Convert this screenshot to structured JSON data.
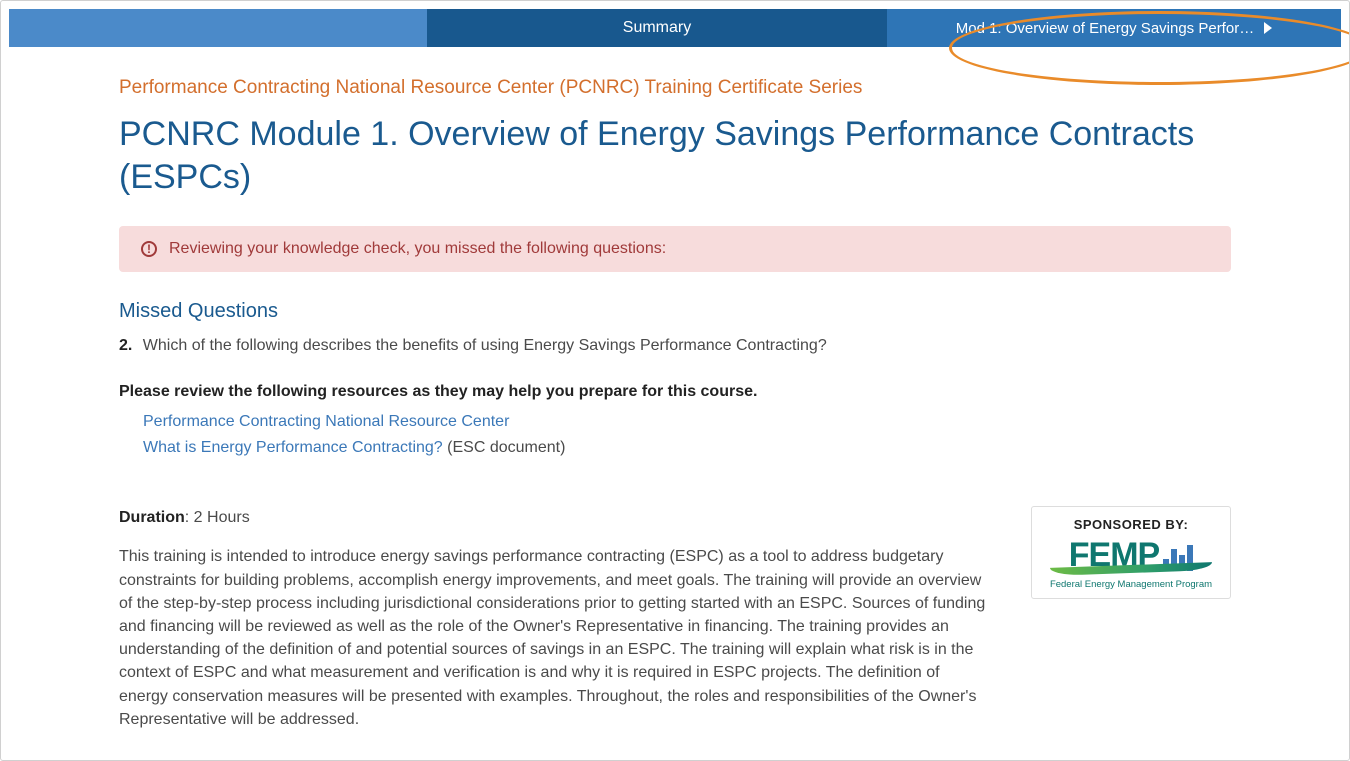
{
  "nav": {
    "center_label": "Summary",
    "right_label": "Mod 1: Overview of Energy Savings Perfor…"
  },
  "header": {
    "series": "Performance Contracting National Resource Center (PCNRC) Training Certificate Series",
    "title": "PCNRC Module 1. Overview of Energy Savings Performance Contracts (ESPCs)"
  },
  "alert": {
    "text": "Reviewing your knowledge check, you missed the following questions:"
  },
  "missed": {
    "heading": "Missed Questions",
    "items": [
      {
        "num": "2.",
        "text": "Which of the following describes the benefits of using Energy Savings Performance Contracting?"
      }
    ]
  },
  "review": {
    "intro": "Please review the following resources as they may help you prepare for this course.",
    "resources": [
      {
        "label": "Performance Contracting National Resource Center",
        "after": ""
      },
      {
        "label": "What is Energy Performance Contracting?",
        "after": " (ESC document)"
      }
    ]
  },
  "duration": {
    "label": "Duration",
    "value": ": 2 Hours"
  },
  "description": "This training is intended to introduce energy savings performance contracting (ESPC) as a tool to address budgetary constraints for building problems, accomplish energy improvements, and meet goals. The training will provide an overview of the step-by-step process including jurisdictional considerations prior to getting started with an ESPC. Sources of funding and financing will be reviewed as well as the role of the Owner's Representative in financing. The training provides an understanding of the definition of and potential sources of savings in an ESPC. The training will explain what risk is in the context of ESPC and what measurement and verification is and why it is required in ESPC projects. The definition of energy conservation measures will be presented with examples. Throughout, the roles and responsibilities of the Owner's Representative will be addressed.",
  "sponsor": {
    "label": "SPONSORED BY:",
    "logo_text": "FEMP",
    "subtitle": "Federal Energy Management Program"
  }
}
